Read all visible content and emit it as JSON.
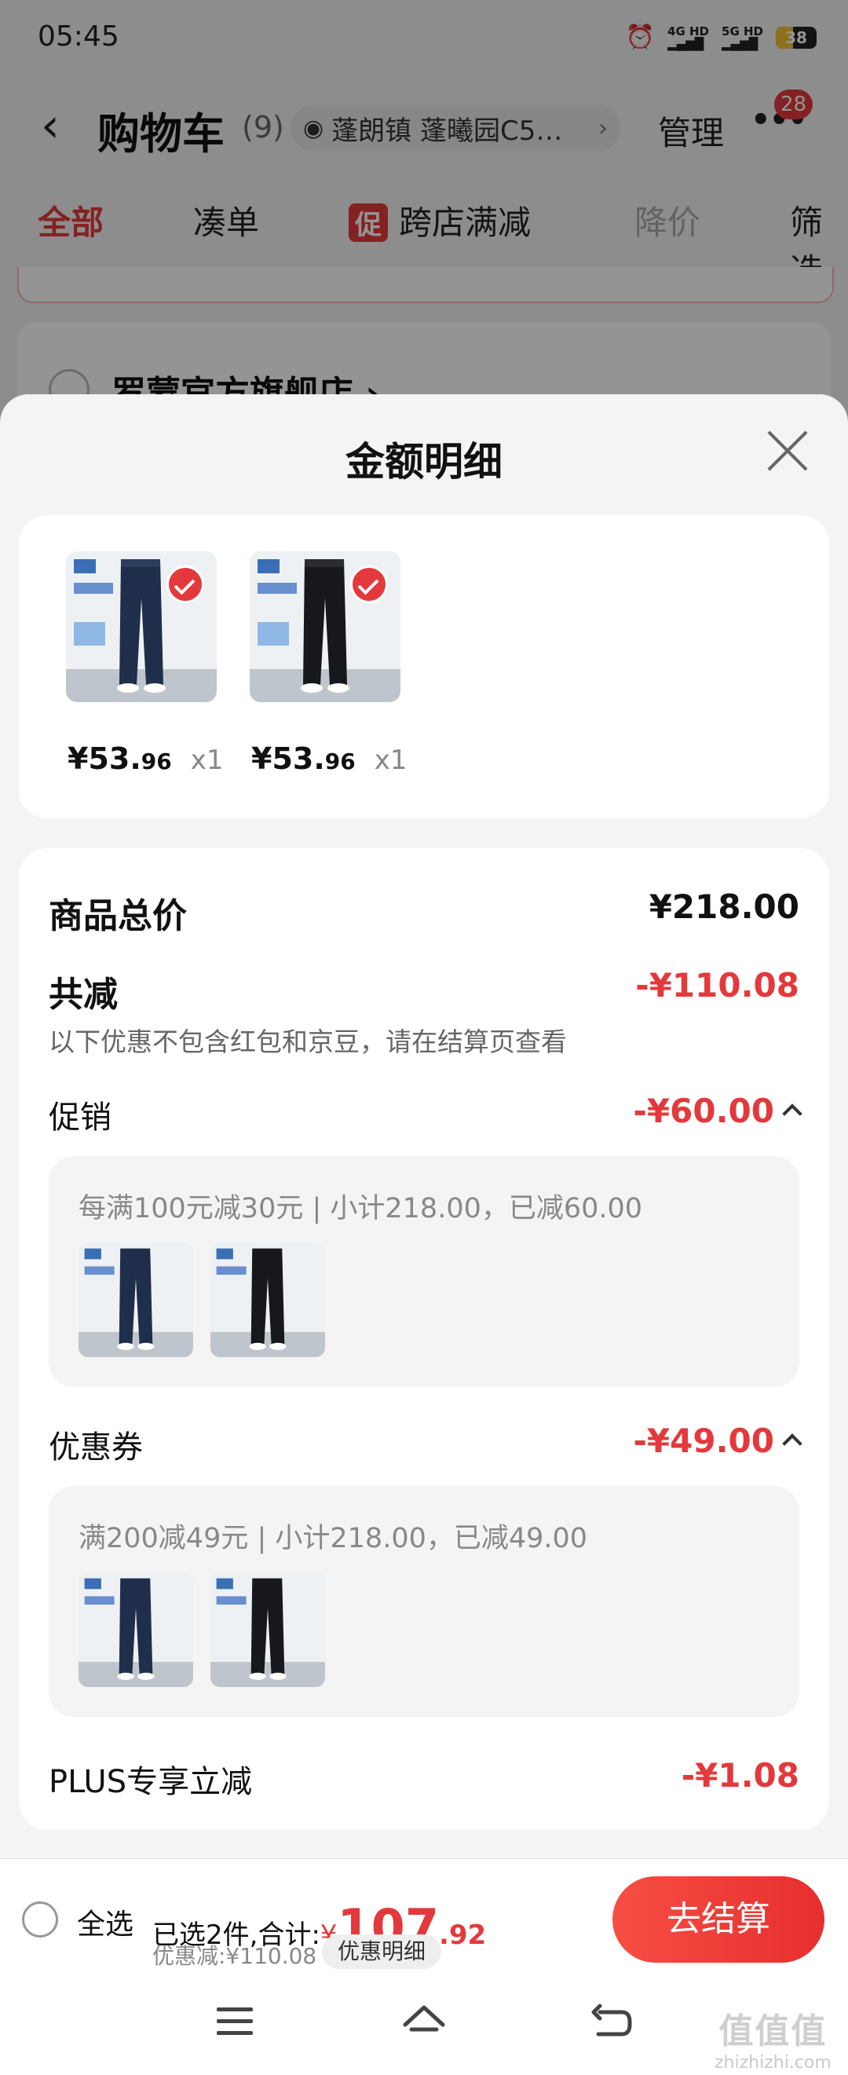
{
  "status_bar": {
    "time": "05:45",
    "network": [
      "4G HD",
      "5G HD"
    ],
    "battery": "38"
  },
  "nav": {
    "back_icon": "chevron-left-icon",
    "title": "购物车",
    "count": "(9)",
    "location": "蓬朗镇 蓬曦园C5…",
    "manage": "管理",
    "more_badge": "28"
  },
  "tabs": {
    "all": "全部",
    "bundle": "凑单",
    "promo_tag": "促",
    "cross_store": "跨店满减",
    "price_drop": "降价",
    "filter": "筛选"
  },
  "background": {
    "store_name": "罗蒙官方旗舰店 ›"
  },
  "sheet": {
    "title": "金额明细",
    "products": [
      {
        "price_main": "¥53.",
        "price_dec": "96",
        "qty": "x1"
      },
      {
        "price_main": "¥53.",
        "price_dec": "96",
        "qty": "x1"
      }
    ],
    "total_label": "商品总价",
    "total_value": "¥218.00",
    "discount_label": "共减",
    "discount_value": "-¥110.08",
    "discount_note": "以下优惠不包含红包和京豆，请在结算页查看",
    "promo_label": "促销",
    "promo_value": "-¥60.00",
    "promo_detail": "每满100元减30元 | 小计218.00，已减60.00",
    "coupon_label": "优惠券",
    "coupon_value": "-¥49.00",
    "coupon_detail": "满200减49元 | 小计218.00，已减49.00",
    "plus_label": "PLUS专享立减",
    "plus_value": "-¥1.08"
  },
  "bottom_bar": {
    "select_all": "全选",
    "selected_text": "已选2件,合计:",
    "rmb": "¥",
    "total_int": "107",
    "total_dec": ".92",
    "discount_text": "优惠减:¥110.08",
    "detail_pill": "优惠明细",
    "checkout": "去结算"
  },
  "watermark": {
    "logo": "值值值",
    "url": "zhizhizhi.com"
  },
  "colors": {
    "accent": "#e4393c",
    "sheet_bg": "#f4f4f4",
    "card_bg": "#ffffff"
  }
}
